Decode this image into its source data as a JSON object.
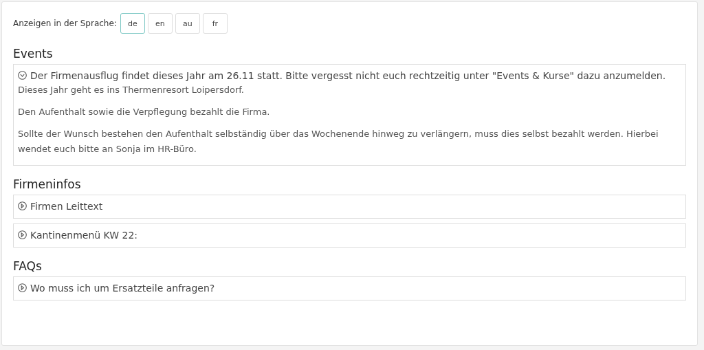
{
  "language_picker": {
    "label": "Anzeigen in der Sprache:",
    "languages": [
      {
        "label": "de",
        "selected": true
      },
      {
        "label": "en",
        "selected": false
      },
      {
        "label": "au",
        "selected": false
      },
      {
        "label": "fr",
        "selected": false
      }
    ]
  },
  "sections": [
    {
      "heading": "Events",
      "items": [
        {
          "title": "Der Firmenausflug findet dieses Jahr am 26.11 statt. Bitte vergesst nicht euch rechtzeitig unter \"Events & Kurse\" dazu anzumelden.",
          "expanded": true,
          "paragraphs": [
            "Dieses Jahr geht es ins Thermenresort Loipersdorf.",
            "Den Aufenthalt sowie die Verpflegung bezahlt die Firma.",
            "Sollte der Wunsch bestehen den Aufenthalt selbständig über das Wochenende hinweg zu verlängern, muss dies selbst bezahlt werden. Hierbei wendet euch bitte an Sonja im HR-Büro."
          ]
        }
      ]
    },
    {
      "heading": "Firmeninfos",
      "items": [
        {
          "title": "Firmen Leittext",
          "expanded": false
        },
        {
          "title": "Kantinenmenü KW 22:",
          "expanded": false
        }
      ]
    },
    {
      "heading": "FAQs",
      "items": [
        {
          "title": "Wo muss ich um Ersatzteile anfragen?",
          "expanded": false
        }
      ]
    }
  ]
}
